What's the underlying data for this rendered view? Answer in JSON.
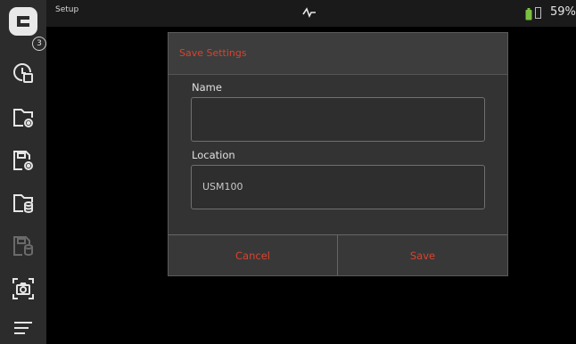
{
  "statusbar": {
    "app_title": "Setup",
    "battery_percent": "59%",
    "battery_color": "#7ac142"
  },
  "sidebar": {
    "badge_count": "3",
    "items": [
      {
        "icon": "clock-save-icon"
      },
      {
        "icon": "folder-settings-icon"
      },
      {
        "icon": "file-settings-icon"
      },
      {
        "icon": "folder-database-icon"
      },
      {
        "icon": "file-database-icon",
        "disabled": true
      },
      {
        "icon": "screenshot-camera-icon"
      },
      {
        "icon": "menu-icon"
      }
    ]
  },
  "dialog": {
    "title": "Save Settings",
    "name_label": "Name",
    "name_value": "",
    "location_label": "Location",
    "location_value": "USM100",
    "cancel_label": "Cancel",
    "save_label": "Save",
    "accent_color": "#d9432e"
  }
}
